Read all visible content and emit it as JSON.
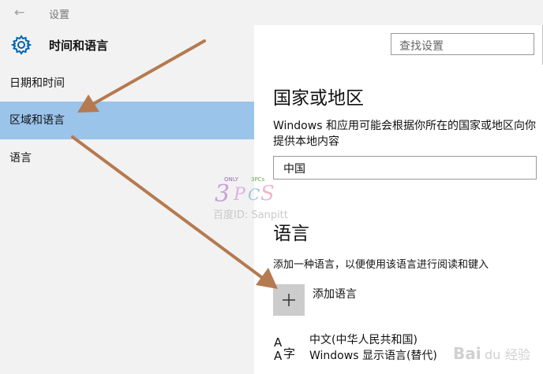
{
  "window": {
    "title": "设置",
    "back_glyph": "←"
  },
  "header": {
    "title": "时间和语言",
    "icon": "gear-icon"
  },
  "search": {
    "placeholder": "查找设置"
  },
  "sidebar": {
    "items": [
      {
        "label": "日期和时间",
        "selected": false
      },
      {
        "label": "区域和语言",
        "selected": true
      },
      {
        "label": "语言",
        "selected": false
      }
    ]
  },
  "region": {
    "heading": "国家或地区",
    "description": "Windows 和应用可能会根据你所在的国家或地区向你提供本地内容",
    "selected_country": "中国"
  },
  "languages": {
    "heading": "语言",
    "description": "添加一种语言，以便使用该语言进行阅读和键入",
    "add_label": "添加语言",
    "items": [
      {
        "name": "中文(中华人民共和国)",
        "sub": "Windows 显示语言(替代)"
      }
    ]
  },
  "watermark": {
    "text": "百度ID: Sanpitt"
  },
  "colors": {
    "selected_nav": "#9ac4ea",
    "accent": "#0063b1",
    "arrow": "#b57a50",
    "sidebar_bg": "#f2f2f2"
  }
}
